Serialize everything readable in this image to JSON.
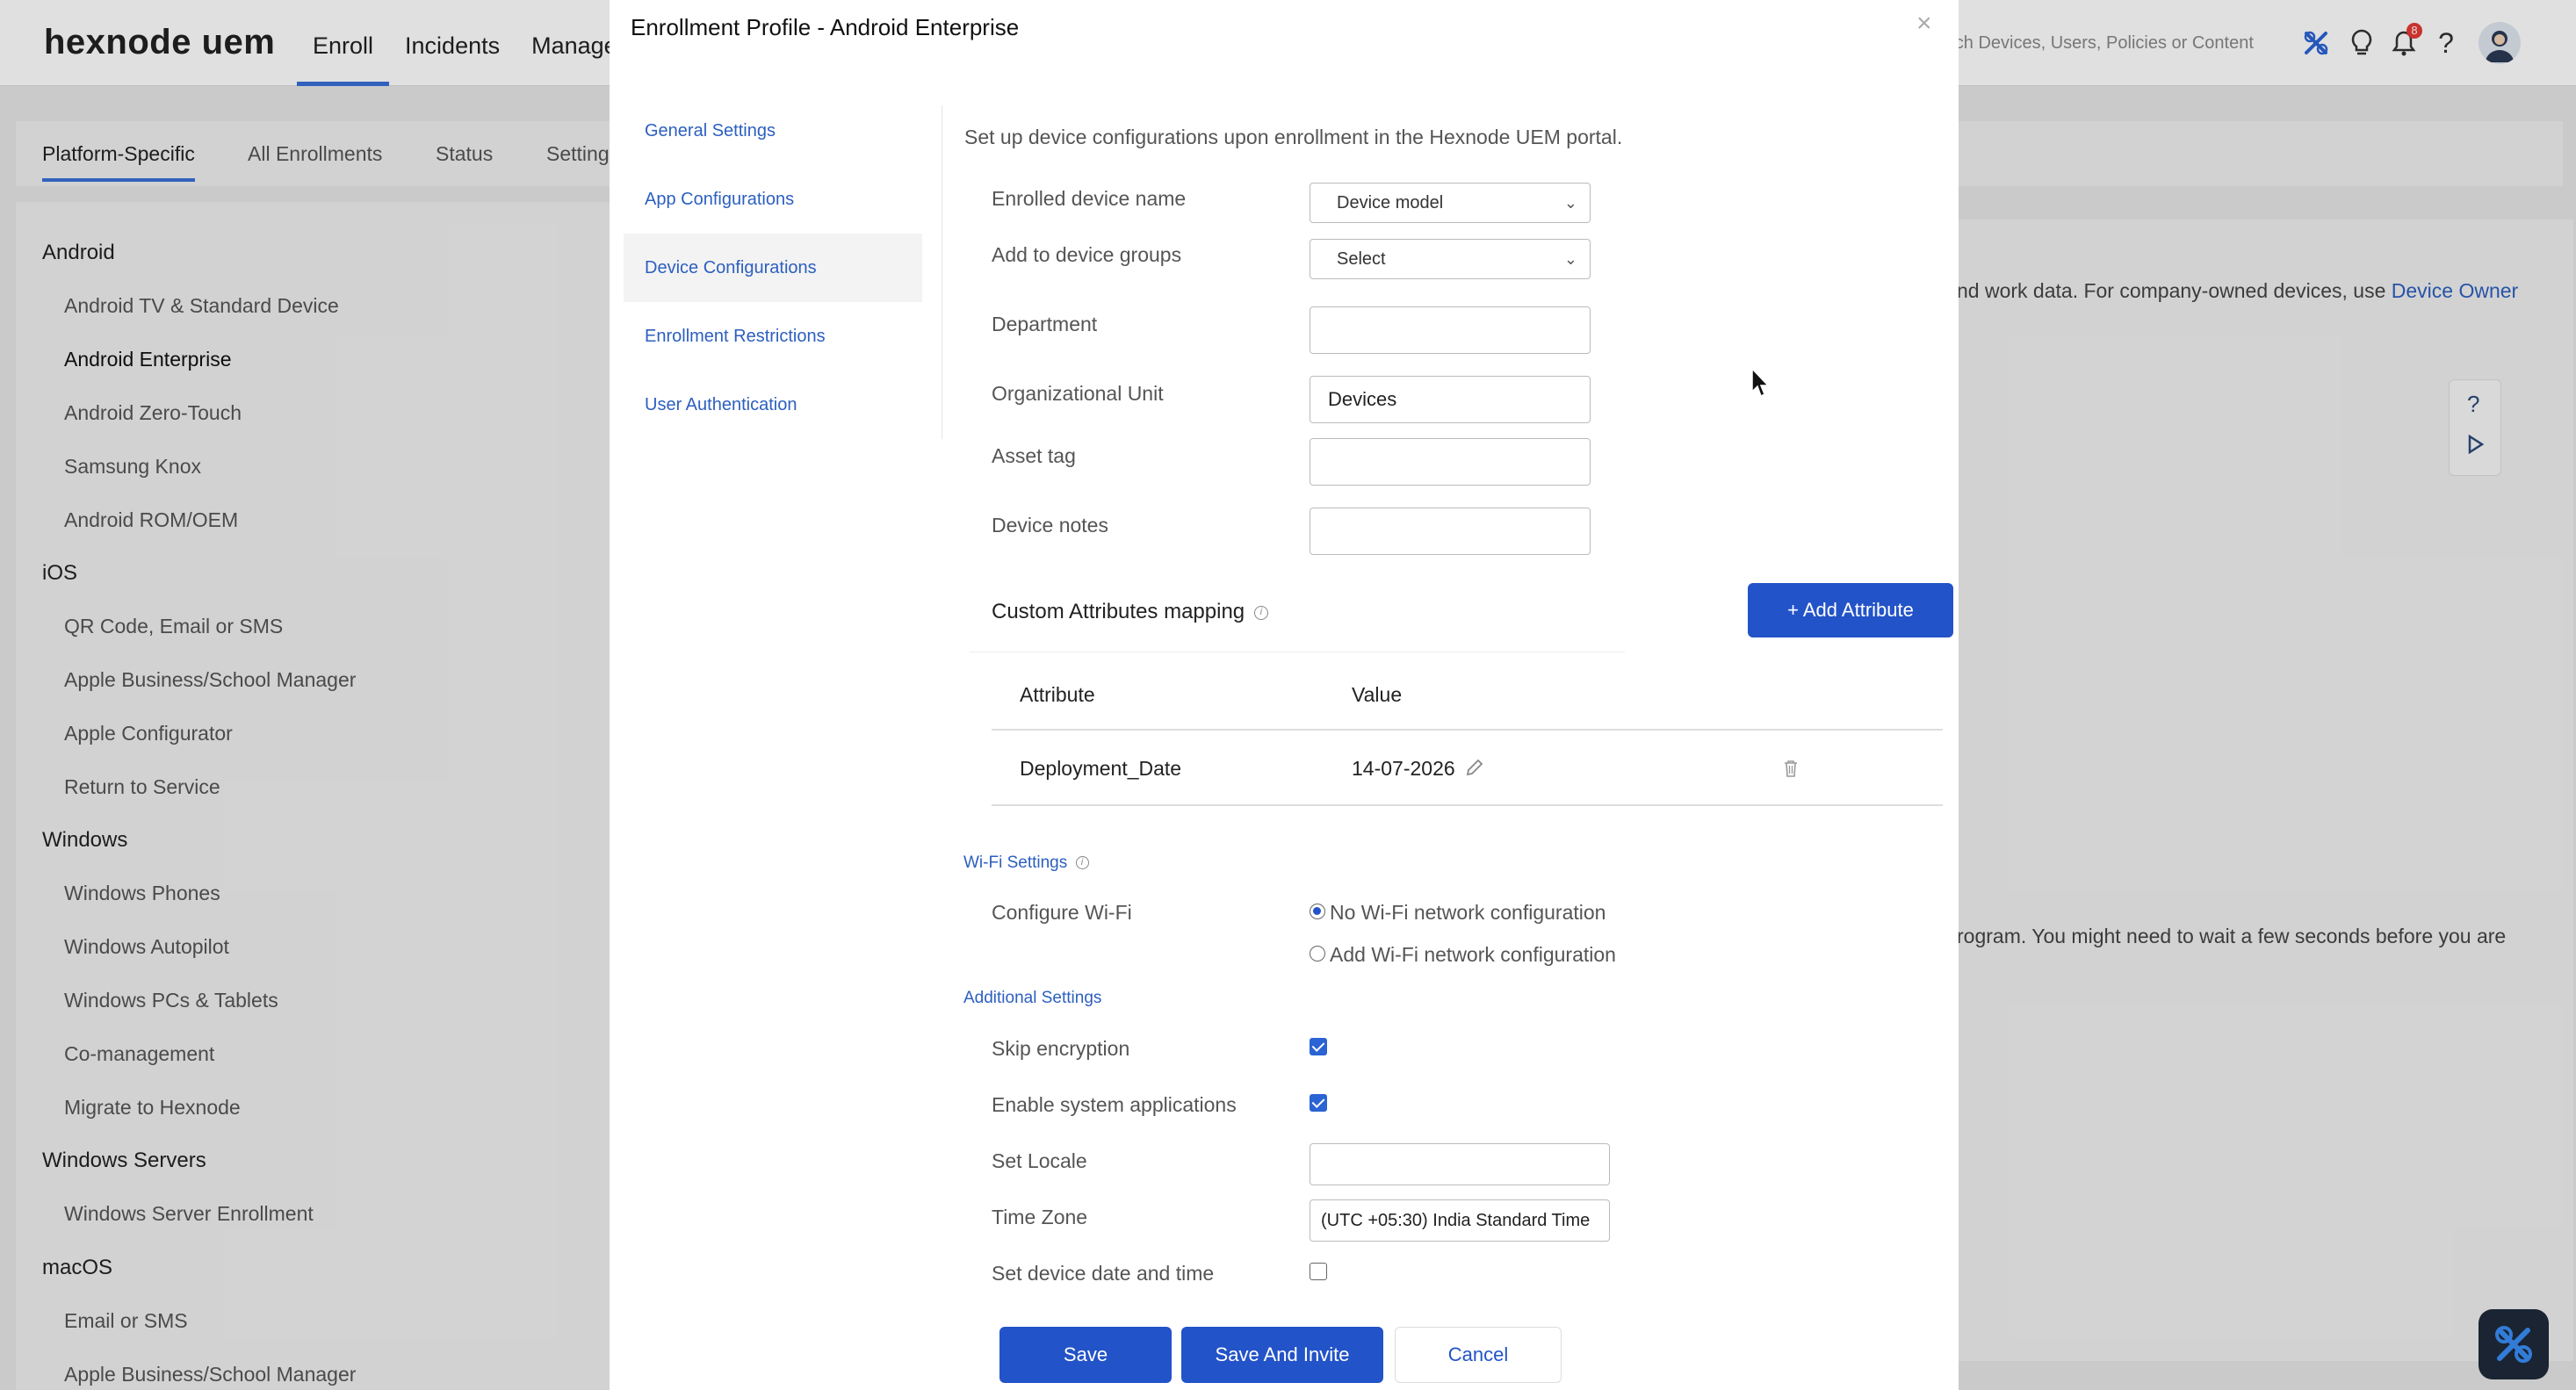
{
  "topbar": {
    "logo": "hexnode uem",
    "nav": [
      "Enroll",
      "Incidents",
      "Manage"
    ],
    "search_placeholder": "arch Devices, Users, Policies or Content",
    "notification_count": "8"
  },
  "subtabs": [
    "Platform-Specific",
    "All Enrollments",
    "Status",
    "Setting"
  ],
  "sidebar": {
    "items": [
      {
        "label": "Android",
        "group": true
      },
      {
        "label": "Android TV & Standard Device"
      },
      {
        "label": "Android Enterprise"
      },
      {
        "label": "Android Zero-Touch"
      },
      {
        "label": "Samsung Knox"
      },
      {
        "label": "Android ROM/OEM"
      },
      {
        "label": "iOS",
        "group": true
      },
      {
        "label": "QR Code, Email or SMS"
      },
      {
        "label": "Apple Business/School Manager"
      },
      {
        "label": "Apple Configurator"
      },
      {
        "label": "Return to Service"
      },
      {
        "label": "Windows",
        "group": true
      },
      {
        "label": "Windows Phones"
      },
      {
        "label": "Windows Autopilot"
      },
      {
        "label": "Windows PCs & Tablets"
      },
      {
        "label": "Co-management"
      },
      {
        "label": "Migrate to Hexnode"
      },
      {
        "label": "Windows Servers",
        "group": true
      },
      {
        "label": "Windows Server Enrollment"
      },
      {
        "label": "macOS",
        "group": true
      },
      {
        "label": "Email or SMS"
      },
      {
        "label": "Apple Business/School Manager"
      }
    ]
  },
  "background": {
    "text1": "nd work data. For company-owned devices, use ",
    "link1": "Device Owner",
    "text2": "rogram. You might need to wait a few seconds before you are"
  },
  "modal": {
    "title": "Enrollment Profile - Android Enterprise",
    "nav": [
      "General Settings",
      "App Configurations",
      "Device Configurations",
      "Enrollment Restrictions",
      "User Authentication"
    ],
    "intro": "Set up device configurations upon enrollment in the Hexnode UEM portal.",
    "fields": {
      "enrolled_device_name": {
        "label": "Enrolled device name",
        "value": "Device model"
      },
      "add_to_groups": {
        "label": "Add to device groups",
        "value": "Select"
      },
      "department": {
        "label": "Department",
        "value": ""
      },
      "org_unit": {
        "label": "Organizational Unit",
        "value": "Devices"
      },
      "asset_tag": {
        "label": "Asset tag",
        "value": ""
      },
      "device_notes": {
        "label": "Device notes",
        "value": ""
      }
    },
    "custom_attr": {
      "title": "Custom Attributes mapping",
      "add_button": "+ Add Attribute",
      "col_attribute": "Attribute",
      "col_value": "Value",
      "rows": [
        {
          "attribute": "Deployment_Date",
          "value": "14-07-2026"
        }
      ]
    },
    "wifi": {
      "title": "Wi-Fi Settings",
      "label": "Configure Wi-Fi",
      "option_none": "No Wi-Fi network configuration",
      "option_add": "Add Wi-Fi network configuration"
    },
    "additional": {
      "title": "Additional Settings",
      "skip_encryption": "Skip encryption",
      "enable_system_apps": "Enable system applications",
      "set_locale": "Set Locale",
      "locale_value": "",
      "time_zone": "Time Zone",
      "time_zone_value": "(UTC +05:30) India Standard Time",
      "set_date_time": "Set device date and time"
    },
    "buttons": {
      "save": "Save",
      "save_invite": "Save And Invite",
      "cancel": "Cancel"
    }
  },
  "colors": {
    "accent": "#2353c8",
    "link": "#2c5fbf"
  }
}
